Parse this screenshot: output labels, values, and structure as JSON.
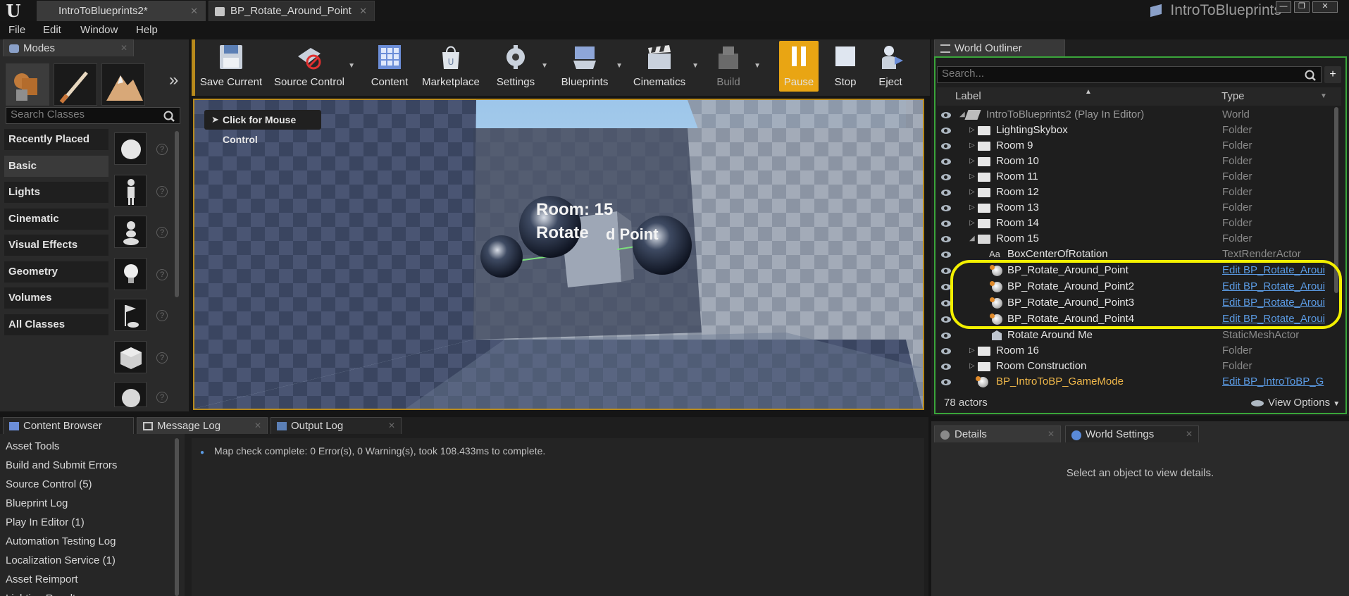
{
  "titlebar": {
    "tabs": [
      {
        "label": "IntroToBlueprints2*"
      },
      {
        "label": "BP_Rotate_Around_Point"
      }
    ],
    "project_name": "IntroToBlueprints"
  },
  "menu": [
    "File",
    "Edit",
    "Window",
    "Help"
  ],
  "modes": {
    "tab_label": "Modes",
    "search_placeholder": "Search Classes",
    "categories": [
      "Recently Placed",
      "Basic",
      "Lights",
      "Cinematic",
      "Visual Effects",
      "Geometry",
      "Volumes",
      "All Classes"
    ],
    "selected_category": "Basic"
  },
  "toolbar": {
    "buttons": [
      "Save Current",
      "Source Control",
      "Content",
      "Marketplace",
      "Settings",
      "Blueprints",
      "Cinematics",
      "Build",
      "Pause",
      "Stop",
      "Eject"
    ]
  },
  "viewport": {
    "mouse_control": "Click for Mouse Control",
    "overlay_line1": "Room: 15",
    "overlay_line2": "Rotate",
    "overlay_line2b": "d Point"
  },
  "outliner": {
    "tab_label": "World Outliner",
    "search_placeholder": "Search...",
    "col_label": "Label",
    "col_type": "Type",
    "rows": [
      {
        "label": "IntroToBlueprints2 (Play In Editor)",
        "type": "World"
      },
      {
        "label": "LightingSkybox",
        "type": "Folder"
      },
      {
        "label": "Room 9",
        "type": "Folder"
      },
      {
        "label": "Room 10",
        "type": "Folder"
      },
      {
        "label": "Room 11",
        "type": "Folder"
      },
      {
        "label": "Room 12",
        "type": "Folder"
      },
      {
        "label": "Room 13",
        "type": "Folder"
      },
      {
        "label": "Room 14",
        "type": "Folder"
      },
      {
        "label": "Room 15",
        "type": "Folder"
      },
      {
        "label": "BoxCenterOfRotation",
        "type": "TextRenderActor"
      },
      {
        "label": "BP_Rotate_Around_Point",
        "type": "Edit BP_Rotate_Aroui"
      },
      {
        "label": "BP_Rotate_Around_Point2",
        "type": "Edit BP_Rotate_Aroui"
      },
      {
        "label": "BP_Rotate_Around_Point3",
        "type": "Edit BP_Rotate_Aroui"
      },
      {
        "label": "BP_Rotate_Around_Point4",
        "type": "Edit BP_Rotate_Aroui"
      },
      {
        "label": "Rotate Around Me",
        "type": "StaticMeshActor"
      },
      {
        "label": "Room 16",
        "type": "Folder"
      },
      {
        "label": "Room Construction",
        "type": "Folder"
      },
      {
        "label": "BP_IntroToBP_GameMode",
        "type": "Edit BP_IntroToBP_G"
      }
    ],
    "actor_count": "78 actors",
    "view_options": "View Options"
  },
  "bottom_tabs": [
    "Content Browser",
    "Message Log",
    "Output Log"
  ],
  "message_log": {
    "categories": [
      "Asset Tools",
      "Build and Submit Errors",
      "Source Control (5)",
      "Blueprint Log",
      "Play In Editor (1)",
      "Automation Testing Log",
      "Localization Service (1)",
      "Asset Reimport",
      "Lighting Results"
    ],
    "message": "Map check complete: 0 Error(s), 0 Warning(s), took 108.433ms to complete."
  },
  "details": {
    "tabs": [
      "Details",
      "World Settings"
    ],
    "empty_text": "Select an object to view details."
  },
  "colors": {
    "accent_pause": "#e9a513",
    "highlight_ring": "#f3f000",
    "outliner_border": "#3aa53a",
    "link": "#5b9be4"
  }
}
